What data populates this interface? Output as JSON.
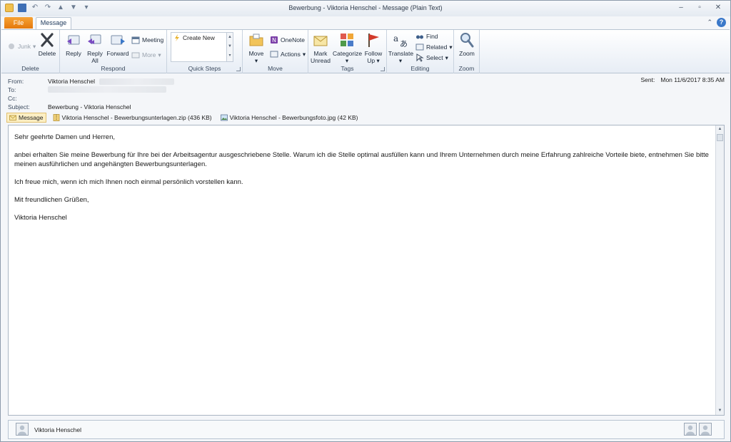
{
  "window": {
    "title": "Bewerbung - Viktoria Henschel - Message (Plain Text)"
  },
  "tabs": {
    "file": "File",
    "message": "Message"
  },
  "ribbon": {
    "delete_group": {
      "label": "Delete",
      "junk": "Junk",
      "delete": "Delete"
    },
    "respond_group": {
      "label": "Respond",
      "reply": "Reply",
      "reply_all_1": "Reply",
      "reply_all_2": "All",
      "forward": "Forward",
      "meeting": "Meeting",
      "more": "More"
    },
    "quicksteps_group": {
      "label": "Quick Steps",
      "create_new": "Create New"
    },
    "move_group": {
      "label": "Move",
      "move": "Move",
      "onenote": "OneNote",
      "actions": "Actions"
    },
    "tags_group": {
      "label": "Tags",
      "mark_unread_1": "Mark",
      "mark_unread_2": "Unread",
      "categorize": "Categorize",
      "follow_up_1": "Follow",
      "follow_up_2": "Up"
    },
    "editing_group": {
      "label": "Editing",
      "translate": "Translate",
      "find": "Find",
      "related": "Related",
      "select": "Select"
    },
    "zoom_group": {
      "label": "Zoom",
      "zoom": "Zoom"
    }
  },
  "header": {
    "from_label": "From:",
    "from_value": "Viktoria Henschel",
    "to_label": "To:",
    "cc_label": "Cc:",
    "subject_label": "Subject:",
    "subject_value": "Bewerbung - Viktoria Henschel",
    "sent_label": "Sent:",
    "sent_value": "Mon 11/6/2017 8:35 AM"
  },
  "attachments": {
    "message": "Message",
    "files": [
      "Viktoria Henschel - Bewerbungsunterlagen.zip (436 KB)",
      "Viktoria Henschel - Bewerbungsfoto.jpg (42 KB)"
    ]
  },
  "body": {
    "greeting": "Sehr geehrte Damen und Herren,",
    "paragraph1": "anbei erhalten Sie meine Bewerbung für Ihre bei der Arbeitsagentur ausgeschriebene Stelle. Warum ich die Stelle optimal ausfüllen kann und Ihrem Unternehmen durch meine Erfahrung zahlreiche Vorteile biete, entnehmen Sie bitte meinen ausführlichen und angehängten Bewerbungsunterlagen.",
    "paragraph2": "Ich freue mich, wenn ich mich Ihnen noch einmal persönlich vorstellen kann.",
    "closing": "Mit freundlichen Grüßen,",
    "signature": "Viktoria Henschel"
  },
  "people_pane": {
    "name": "Viktoria Henschel"
  },
  "colors": {
    "file_tab": "#e4780c",
    "accent": "#3a78c9"
  }
}
